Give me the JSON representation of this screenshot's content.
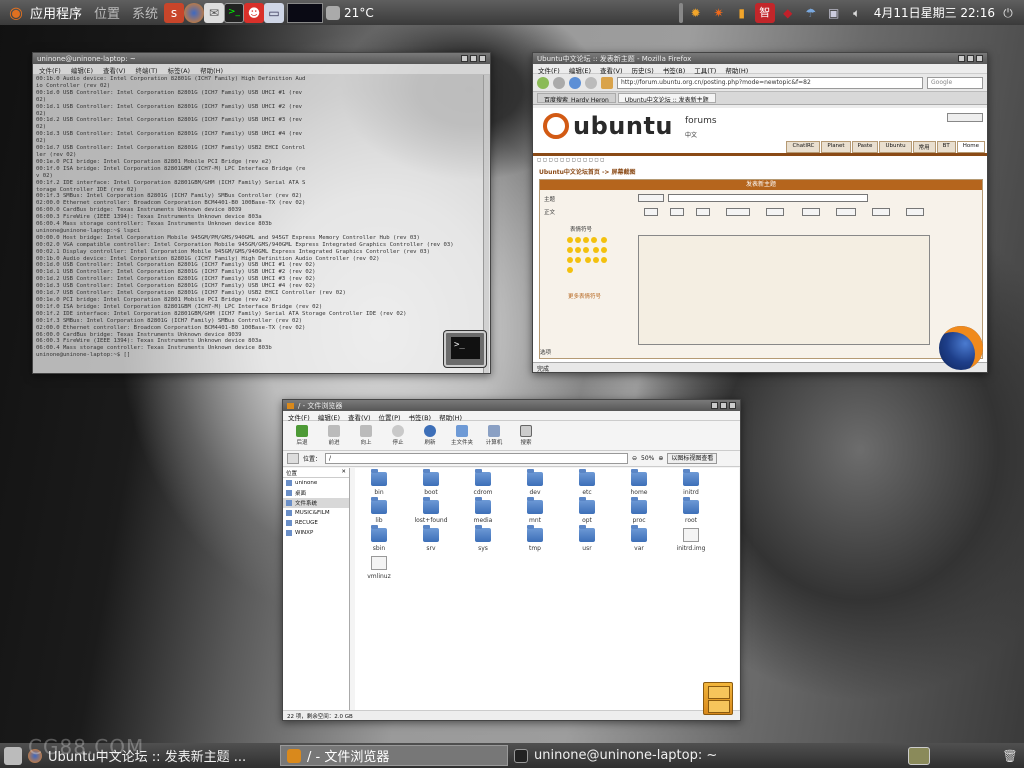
{
  "top_panel": {
    "apps_label": "应用程序",
    "places_label": "位置",
    "system_label": "系统",
    "temperature": "21°C",
    "clock": "4月11日星期三 22:16"
  },
  "terminal": {
    "title": "uninone@uninone-laptop: ~",
    "menu": [
      "文件(F)",
      "编辑(E)",
      "查看(V)",
      "终端(T)",
      "标签(A)",
      "帮助(H)"
    ],
    "lines": [
      "00:1b.0 Audio device: Intel Corporation 82801G (ICH7 Family) High Definition Aud",
      "io Controller (rev 02)",
      "00:1d.0 USB Controller: Intel Corporation 82801G (ICH7 Family) USB UHCI #1 (rev",
      "02)",
      "00:1d.1 USB Controller: Intel Corporation 82801G (ICH7 Family) USB UHCI #2 (rev",
      "02)",
      "00:1d.2 USB Controller: Intel Corporation 82801G (ICH7 Family) USB UHCI #3 (rev",
      "02)",
      "00:1d.3 USB Controller: Intel Corporation 82801G (ICH7 Family) USB UHCI #4 (rev",
      "02)",
      "00:1d.7 USB Controller: Intel Corporation 82801G (ICH7 Family) USB2 EHCI Control",
      "ler (rev 02)",
      "00:1e.0 PCI bridge: Intel Corporation 82801 Mobile PCI Bridge (rev e2)",
      "00:1f.0 ISA bridge: Intel Corporation 82801GBM (ICH7-M) LPC Interface Bridge (re",
      "v 02)",
      "00:1f.2 IDE interface: Intel Corporation 82801GBM/GHM (ICH7 Family) Serial ATA S",
      "torage Controller IDE (rev 02)",
      "00:1f.3 SMBus: Intel Corporation 82801G (ICH7 Family) SMBus Controller (rev 02)",
      "02:00.0 Ethernet controller: Broadcom Corporation BCM4401-B0 100Base-TX (rev 02)",
      "06:00.0 CardBus bridge: Texas Instruments Unknown device 8039",
      "06:00.3 FireWire (IEEE 1394): Texas Instruments Unknown device 803a",
      "06:00.4 Mass storage controller: Texas Instruments Unknown device 803b",
      "uninone@uninone-laptop:~$ lspci",
      "00:00.0 Host bridge: Intel Corporation Mobile 945GM/PM/GMS/940GML and 945GT Express Memory Controller Hub (rev 03)",
      "00:02.0 VGA compatible controller: Intel Corporation Mobile 945GM/GMS/940GML Express Integrated Graphics Controller (rev 03)",
      "00:02.1 Display controller: Intel Corporation Mobile 945GM/GMS/940GML Express Integrated Graphics Controller (rev 03)",
      "00:1b.0 Audio device: Intel Corporation 82801G (ICH7 Family) High Definition Audio Controller (rev 02)",
      "00:1d.0 USB Controller: Intel Corporation 82801G (ICH7 Family) USB UHCI #1 (rev 02)",
      "00:1d.1 USB Controller: Intel Corporation 82801G (ICH7 Family) USB UHCI #2 (rev 02)",
      "00:1d.2 USB Controller: Intel Corporation 82801G (ICH7 Family) USB UHCI #3 (rev 02)",
      "00:1d.3 USB Controller: Intel Corporation 82801G (ICH7 Family) USB UHCI #4 (rev 02)",
      "00:1d.7 USB Controller: Intel Corporation 82801G (ICH7 Family) USB2 EHCI Controller (rev 02)",
      "00:1e.0 PCI bridge: Intel Corporation 82801 Mobile PCI Bridge (rev e2)",
      "00:1f.0 ISA bridge: Intel Corporation 82801GBM (ICH7-M) LPC Interface Bridge (rev 02)",
      "00:1f.2 IDE interface: Intel Corporation 82801GBM/GHM (ICH7 Family) Serial ATA Storage Controller IDE (rev 02)",
      "00:1f.3 SMBus: Intel Corporation 82801G (ICH7 Family) SMBus Controller (rev 02)",
      "02:00.0 Ethernet controller: Broadcom Corporation BCM4401-B0 100Base-TX (rev 02)",
      "06:00.0 CardBus bridge: Texas Instruments Unknown device 8039",
      "06:00.3 FireWire (IEEE 1394): Texas Instruments Unknown device 803a",
      "06:00.4 Mass storage controller: Texas Instruments Unknown device 803b",
      "uninone@uninone-laptop:~$ []"
    ]
  },
  "firefox": {
    "title": "Ubuntu中文论坛 :: 发表新主题 - Mozilla Firefox",
    "menu": [
      "文件(F)",
      "编辑(E)",
      "查看(V)",
      "历史(S)",
      "书签(B)",
      "工具(T)",
      "帮助(H)"
    ],
    "url": "http://forum.ubuntu.org.cn/posting.php?mode=newtopic&f=82",
    "search_placeholder": "Google",
    "tabs": [
      "百度搜索_Hardy Heron",
      "Ubuntu中文论坛 :: 发表新主题"
    ],
    "forums_label": "forums",
    "zh_label": "中文",
    "site_tabs": [
      "ChatIRC",
      "Planet",
      "Paste",
      "Ubuntu",
      "常用",
      "BT",
      "Home"
    ],
    "bread": "Ubuntu中文论坛首页 -> 屏幕截图",
    "box_title": "发表新主题",
    "subject_label": "主题",
    "content_label": "正文",
    "smilies_label": "表情符号",
    "more_smilies": "更多表情符号",
    "options_label": "选项",
    "status": "完成"
  },
  "filemanager": {
    "title": "/ - 文件浏览器",
    "menu": [
      "文件(F)",
      "编辑(E)",
      "查看(V)",
      "位置(P)",
      "书签(B)",
      "帮助(H)"
    ],
    "toolbar": [
      "后退",
      "前进",
      "向上",
      "停止",
      "刷新",
      "主文件夹",
      "计算机",
      "搜索"
    ],
    "location_label": "位置：",
    "location_value": "/",
    "zoom": "50%",
    "view_mode": "以图标视图查看",
    "side_header": "位置",
    "side_items": [
      "uninone",
      "桌面",
      "文件系统",
      "MUSIC&FILM",
      "RECUGE",
      "WINXP"
    ],
    "items": [
      "bin",
      "boot",
      "cdrom",
      "dev",
      "etc",
      "home",
      "initrd",
      "lib",
      "lost+found",
      "media",
      "mnt",
      "opt",
      "proc",
      "root",
      "sbin",
      "srv",
      "sys",
      "tmp",
      "usr",
      "var",
      "initrd.img",
      "vmlinuz"
    ],
    "status": "22 项，剩余空间：2.0 GB"
  },
  "taskbar": {
    "items": [
      "Ubuntu中文论坛 :: 发表新主题 ...",
      "/ - 文件浏览器",
      "uninone@uninone-laptop: ~"
    ]
  },
  "watermark": "CG88.COM"
}
